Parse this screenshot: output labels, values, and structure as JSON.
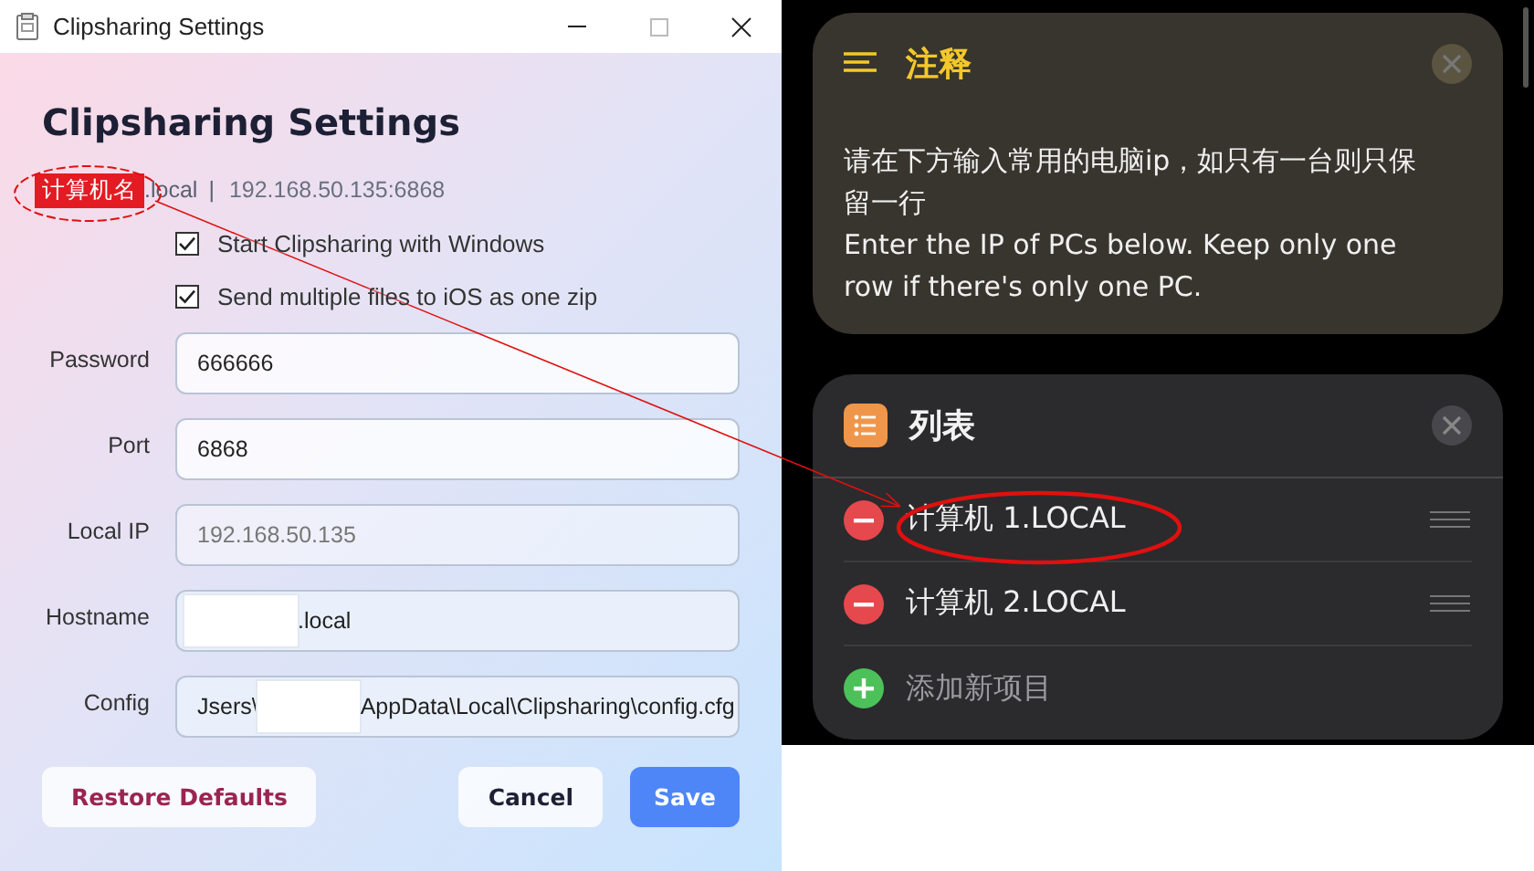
{
  "window": {
    "title": "Clipsharing Settings"
  },
  "settings": {
    "heading": "Clipsharing Settings",
    "host_tag": "计算机名",
    "host_suffix": ".local",
    "separator": "|",
    "address": "192.168.50.135:6868",
    "checkboxes": [
      {
        "label": "Start Clipsharing with Windows",
        "checked": true
      },
      {
        "label": "Send multiple files to iOS as one zip",
        "checked": true
      }
    ],
    "fields": [
      {
        "label": "Password",
        "value": "666666",
        "disabled": false
      },
      {
        "label": "Port",
        "value": "6868",
        "disabled": false
      },
      {
        "label": "Local IP",
        "value": "192.168.50.135",
        "disabled": true
      },
      {
        "label": "Hostname",
        "value_after": ".local",
        "redacted": true,
        "disabled": false
      },
      {
        "label": "Config",
        "value_before": "Jsers\\",
        "value_after": "AppData\\Local\\Clipsharing\\config.cfg",
        "redacted": true,
        "disabled": false
      }
    ],
    "buttons": [
      {
        "label": "Restore Defaults",
        "kind": "reset"
      },
      {
        "label": "Cancel",
        "kind": "secondary"
      },
      {
        "label": "Save",
        "kind": "primary"
      }
    ]
  },
  "shortcut": {
    "comment": {
      "title": "注释",
      "lines": [
        "请在下方输入常用的电脑ip，如只有一台则只保留一行",
        "Enter the IP of PCs below. Keep only one row if there's only one PC."
      ]
    },
    "list": {
      "title": "列表",
      "items": [
        {
          "text": "计算机 1.LOCAL"
        },
        {
          "text": "计算机 2.LOCAL"
        }
      ],
      "add_label": "添加新项目"
    }
  }
}
